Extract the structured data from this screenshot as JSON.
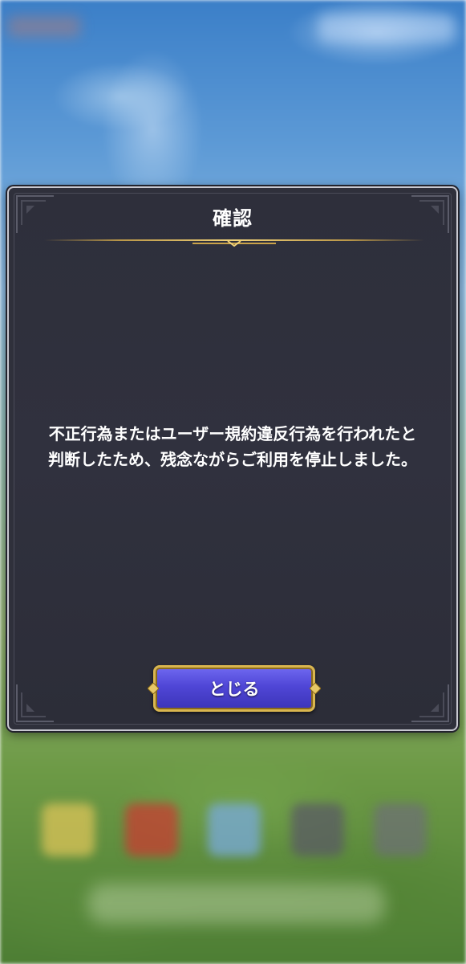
{
  "dialog": {
    "title": "確認",
    "message_line1": "不正行為またはユーザー規約違反行為を行われたと",
    "message_line2": "判断したため、残念ながらご利用を停止しました。",
    "close_label": "とじる"
  },
  "colors": {
    "panel": "#2f303b",
    "border": "#c8c8d0",
    "gold": "#d9b64f",
    "button": "#4f46d6"
  },
  "icons": {
    "divider": "ornament-divider-icon",
    "corner": "corner-ornament-icon",
    "gem": "diamond-gem-icon"
  }
}
